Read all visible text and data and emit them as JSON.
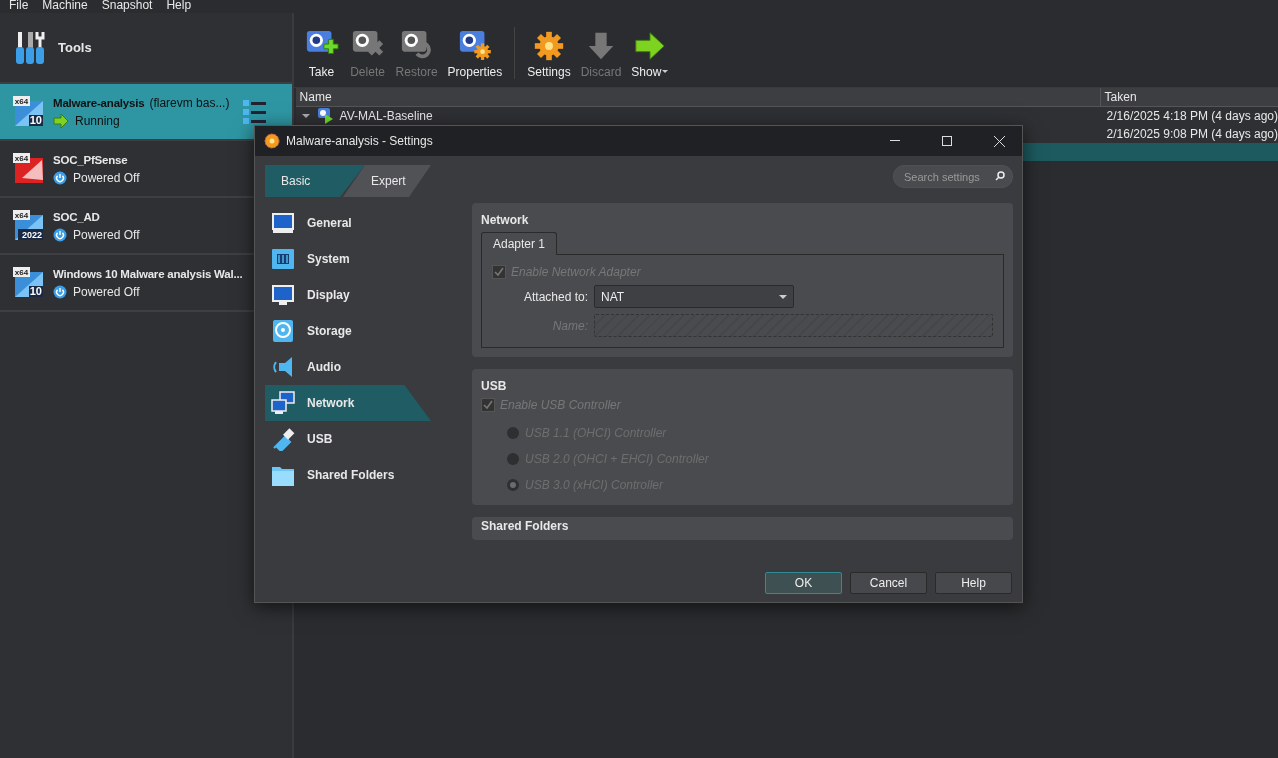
{
  "menu": [
    {
      "label": "File"
    },
    {
      "label": "Machine"
    },
    {
      "label": "Snapshot"
    },
    {
      "label": "Help"
    }
  ],
  "tools": {
    "label": "Tools"
  },
  "vms": [
    {
      "name": "Malware-analysis",
      "note": "(flarevm bas...)",
      "status": "Running",
      "kind": "running",
      "arch": "x64",
      "os": "10",
      "selected": true
    },
    {
      "name": "SOC_PfSense",
      "status": "Powered Off",
      "kind": "off",
      "arch": "x64",
      "selected": false
    },
    {
      "name": "SOC_AD",
      "status": "Powered Off",
      "kind": "off",
      "arch": "x64",
      "os": "2022",
      "selected": false
    },
    {
      "name": "Windows 10 Malware analysis Wal...",
      "status": "Powered Off",
      "kind": "off",
      "arch": "x64",
      "os": "10",
      "selected": false
    }
  ],
  "toolbar": [
    {
      "label": "Take",
      "kind": "take",
      "disabled": false
    },
    {
      "label": "Delete",
      "kind": "delete",
      "disabled": true
    },
    {
      "label": "Restore",
      "kind": "restore",
      "disabled": true
    },
    {
      "label": "Properties",
      "kind": "properties",
      "disabled": false
    },
    {
      "label": "Settings",
      "kind": "settings",
      "disabled": false
    },
    {
      "label": "Discard",
      "kind": "discard",
      "disabled": true
    },
    {
      "label": "Show",
      "kind": "show",
      "disabled": false
    }
  ],
  "snapshots": {
    "columns": [
      "Name",
      "Taken"
    ],
    "rows": [
      {
        "name": "AV-MAL-Baseline",
        "taken": "2/16/2025 4:18 PM (4 days ago)",
        "selected": false
      },
      {
        "taken": "2/16/2025 9:08 PM (4 days ago)",
        "selected": false
      },
      {
        "selected": true
      }
    ]
  },
  "dialog": {
    "title": "Malware-analysis - Settings",
    "modes": [
      {
        "label": "Basic",
        "selected": true
      },
      {
        "label": "Expert",
        "selected": false
      }
    ],
    "search": {
      "placeholder": "Search settings"
    },
    "nav": [
      {
        "label": "General",
        "kind": "general",
        "selected": false
      },
      {
        "label": "System",
        "kind": "system",
        "selected": false
      },
      {
        "label": "Display",
        "kind": "display",
        "selected": false
      },
      {
        "label": "Storage",
        "kind": "storage",
        "selected": false
      },
      {
        "label": "Audio",
        "kind": "audio",
        "selected": false
      },
      {
        "label": "Network",
        "kind": "network",
        "selected": true
      },
      {
        "label": "USB",
        "kind": "usb",
        "selected": false
      },
      {
        "label": "Shared Folders",
        "kind": "folders",
        "selected": false
      }
    ],
    "network": {
      "title": "Network",
      "tabs": [
        {
          "label": "Adapter 1",
          "selected": true
        }
      ],
      "enable": {
        "label": "Enable Network Adapter",
        "checked": true,
        "disabled": true
      },
      "attached": {
        "label": "Attached to:",
        "value": "NAT"
      },
      "name": {
        "label": "Name:",
        "disabled": true
      }
    },
    "usb": {
      "title": "USB",
      "enable": {
        "label": "Enable USB Controller",
        "checked": true,
        "disabled": true
      },
      "options": [
        {
          "label": "USB 1.1 (OHCI) Controller",
          "selected": false
        },
        {
          "label": "USB 2.0 (OHCI + EHCI) Controller",
          "selected": false
        },
        {
          "label": "USB 3.0 (xHCI) Controller",
          "selected": true
        }
      ]
    },
    "next_section": {
      "title": "Shared Folders"
    },
    "buttons": [
      {
        "label": "OK",
        "default": true
      },
      {
        "label": "Cancel",
        "default": false
      },
      {
        "label": "Help",
        "default": false
      }
    ]
  }
}
